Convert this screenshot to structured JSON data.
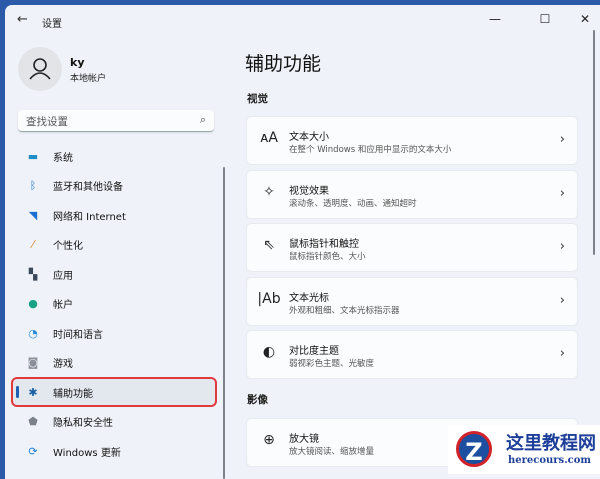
{
  "window": {
    "title": "设置",
    "back_icon": "arrow-left-icon",
    "minimize": "—",
    "maximize": "☐",
    "close": "✕"
  },
  "user": {
    "name": "ky",
    "account_type": "本地帐户"
  },
  "search": {
    "placeholder": "查找设置"
  },
  "nav": [
    {
      "label": "系统",
      "icon": "monitor-icon",
      "glyph": "▬",
      "color": "#1f8dc7"
    },
    {
      "label": "蓝牙和其他设备",
      "icon": "bluetooth-icon",
      "glyph": "ᛒ",
      "color": "#1673c6"
    },
    {
      "label": "网络和 Internet",
      "icon": "wifi-icon",
      "glyph": "◥",
      "color": "#1a6fd0"
    },
    {
      "label": "个性化",
      "icon": "brush-icon",
      "glyph": "⁄",
      "color": "#d6882c"
    },
    {
      "label": "应用",
      "icon": "apps-icon",
      "glyph": "▚",
      "color": "#3a4a5a"
    },
    {
      "label": "帐户",
      "icon": "person-icon",
      "glyph": "●",
      "color": "#1aa383"
    },
    {
      "label": "时间和语言",
      "icon": "globe-clock-icon",
      "glyph": "◔",
      "color": "#2a8ad8"
    },
    {
      "label": "游戏",
      "icon": "gamepad-icon",
      "glyph": "◙",
      "color": "#8a8f98"
    },
    {
      "label": "辅助功能",
      "icon": "accessibility-icon",
      "glyph": "✱",
      "color": "#1b5fa8"
    },
    {
      "label": "隐私和安全性",
      "icon": "shield-icon",
      "glyph": "⬟",
      "color": "#7c828a"
    },
    {
      "label": "Windows 更新",
      "icon": "sync-icon",
      "glyph": "⟳",
      "color": "#1b7fd8"
    }
  ],
  "selected_nav": "辅助功能",
  "main": {
    "title": "辅助功能",
    "sections": [
      {
        "title": "视觉",
        "items": [
          {
            "title": "文本大小",
            "subtitle": "在整个 Windows 和应用中显示的文本大小",
            "icon": "text-size-icon",
            "glyph": "ᴀA"
          },
          {
            "title": "视觉效果",
            "subtitle": "滚动条、透明度、动画、通知超时",
            "icon": "sparkle-icon",
            "glyph": "✧"
          },
          {
            "title": "鼠标指针和触控",
            "subtitle": "鼠标指针颜色、大小",
            "icon": "pointer-touch-icon",
            "glyph": "⇖"
          },
          {
            "title": "文本光标",
            "subtitle": "外观和粗细、文本光标指示器",
            "icon": "text-cursor-icon",
            "glyph": "|Ab"
          },
          {
            "title": "对比度主题",
            "subtitle": "弱视彩色主题、光敏度",
            "icon": "contrast-icon",
            "glyph": "◐"
          }
        ]
      },
      {
        "title": "影像",
        "items": [
          {
            "title": "放大镜",
            "subtitle": "放大镜阅读、缩放增量",
            "icon": "magnifier-icon",
            "glyph": "⊕"
          }
        ]
      }
    ]
  },
  "watermark": {
    "logo": "Z",
    "name": "这里教程网",
    "url": "herecours.com"
  }
}
